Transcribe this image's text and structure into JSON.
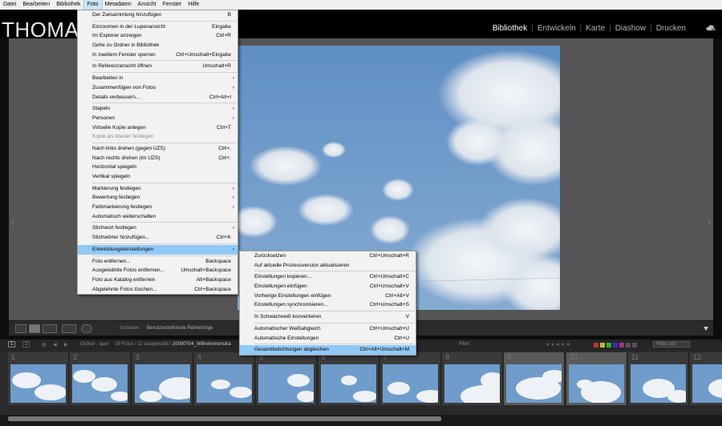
{
  "menubar": [
    "Datei",
    "Bearbeiten",
    "Bibliothek",
    "Foto",
    "Metadaten",
    "Ansicht",
    "Fenster",
    "Hilfe"
  ],
  "logo": "THOMAS",
  "modules": [
    "Bibliothek",
    "Entwickeln",
    "Karte",
    "Diashow",
    "Drucken"
  ],
  "foto_menu": [
    {
      "label": "Der Zielsammlung hinzufügen",
      "sc": "B"
    },
    {
      "sep": true
    },
    {
      "label": "Einzoomen in der Lupenansicht",
      "sc": "Eingabe"
    },
    {
      "label": "Im Explorer anzeigen",
      "sc": "Ctrl+R"
    },
    {
      "label": "Gehe zu Ordner in Bibliothek",
      "sc": ""
    },
    {
      "label": "In zweitem Fenster sperren",
      "sc": "Ctrl+Umschalt+Eingabe"
    },
    {
      "sep": true
    },
    {
      "label": "In Referenzansicht öffnen",
      "sc": "Umschalt+R"
    },
    {
      "sep": true
    },
    {
      "label": "Bearbeiten in",
      "arrow": true
    },
    {
      "label": "Zusammenfügen von Fotos",
      "arrow": true
    },
    {
      "label": "Details verbessern...",
      "sc": "Ctrl+Alt+I"
    },
    {
      "sep": true
    },
    {
      "label": "Stapeln",
      "arrow": true
    },
    {
      "label": "Personen",
      "arrow": true
    },
    {
      "label": "Virtuelle Kopie anlegen",
      "sc": "Ctrl+T"
    },
    {
      "label": "Kopie als Master festlegen",
      "disabled": true
    },
    {
      "sep": true
    },
    {
      "label": "Nach links drehen (gegen UZS)",
      "sc": "Ctrl+,"
    },
    {
      "label": "Nach rechts drehen (im UZS)",
      "sc": "Ctrl+."
    },
    {
      "label": "Horizontal spiegeln",
      "sc": ""
    },
    {
      "label": "Vertikal spiegeln",
      "sc": ""
    },
    {
      "sep": true
    },
    {
      "label": "Markierung festlegen",
      "arrow": true
    },
    {
      "label": "Bewertung festlegen",
      "arrow": true
    },
    {
      "label": "Farbmarkierung festlegen",
      "arrow": true
    },
    {
      "label": "Automatisch weiterschalten",
      "sc": ""
    },
    {
      "sep": true
    },
    {
      "label": "Stichwort festlegen",
      "arrow": true
    },
    {
      "label": "Stichwörter hinzufügen...",
      "sc": "Ctrl+K"
    },
    {
      "sep": true
    },
    {
      "label": "Entwicklungseinstellungen",
      "arrow": true,
      "highlight": true
    },
    {
      "sep": true
    },
    {
      "label": "Foto entfernen...",
      "sc": "Backspace"
    },
    {
      "label": "Ausgewählte Fotos entfernen...",
      "sc": "Umschalt+Backspace"
    },
    {
      "label": "Foto aus Katalog entfernen",
      "sc": "Alt+Backspace"
    },
    {
      "label": "Abgelehnte Fotos löschen...",
      "sc": "Ctrl+Backspace"
    }
  ],
  "sub_menu": [
    {
      "label": "Zurücksetzen",
      "sc": "Ctrl+Umschalt+R"
    },
    {
      "label": "Auf aktuelle Prozessversion aktualisieren",
      "sc": ""
    },
    {
      "sep": true
    },
    {
      "label": "Einstellungen kopieren...",
      "sc": "Ctrl+Umschalt+C"
    },
    {
      "label": "Einstellungen einfügen",
      "sc": "Ctrl+Umschalt+V"
    },
    {
      "label": "Vorherige Einstellungen einfügen",
      "sc": "Ctrl+Alt+V"
    },
    {
      "label": "Einstellungen synchronisieren...",
      "sc": "Ctrl+Umschalt+S"
    },
    {
      "sep": true
    },
    {
      "label": "In Schwarzweiß konvertieren",
      "sc": "V"
    },
    {
      "sep": true
    },
    {
      "label": "Automatischer Weißabgleich",
      "sc": "Ctrl+Umschalt+U"
    },
    {
      "label": "Automatische Einstellungen",
      "sc": "Ctrl+U"
    },
    {
      "sep": true
    },
    {
      "label": "Gesamtbelichtungen abgleichen",
      "sc": "Ctrl+Alt+Umschalt+M",
      "highlight": true
    }
  ],
  "toolbar": {
    "sort_label": "Sortieren",
    "sort_value": "Benutzerdefinierte Reihenfolge"
  },
  "filmbar": {
    "page1": "1",
    "page2": "2",
    "folder": "Ordner : quer",
    "count": "19 Fotos / 12 ausgewählt /",
    "filename": "20090704_Wilhelminenstra",
    "filter_label": "Filter:",
    "filter_value": "Filter aus"
  },
  "film_numbers": [
    "1",
    "2",
    "3",
    "4",
    "5",
    "6",
    "7",
    "8",
    "9",
    "10",
    "11",
    "12"
  ],
  "colors": {
    "menu_highlight": "#91c9f7",
    "sky": "#6f9ccb"
  }
}
